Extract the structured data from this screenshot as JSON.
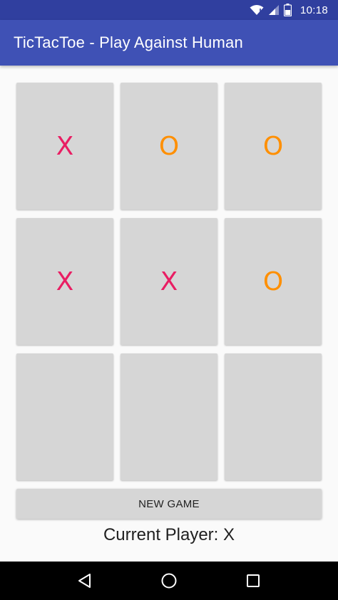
{
  "status_bar": {
    "time": "10:18",
    "icons": [
      "wifi-icon",
      "signal-icon",
      "battery-icon"
    ]
  },
  "app_bar": {
    "title": "TicTacToe - Play Against Human"
  },
  "board": {
    "cells": [
      "X",
      "O",
      "O",
      "X",
      "X",
      "O",
      "",
      "",
      ""
    ]
  },
  "new_game": {
    "label": "NEW GAME"
  },
  "status": {
    "current_player": "Current Player: X"
  },
  "nav_bar": {
    "icons": [
      "back-icon",
      "home-icon",
      "recents-icon"
    ]
  },
  "colors": {
    "primary": "#3f51b5",
    "primary_dark": "#303f9f",
    "x_mark": "#e91e63",
    "o_mark": "#ff8f00",
    "cell_bg": "#d6d6d6"
  }
}
